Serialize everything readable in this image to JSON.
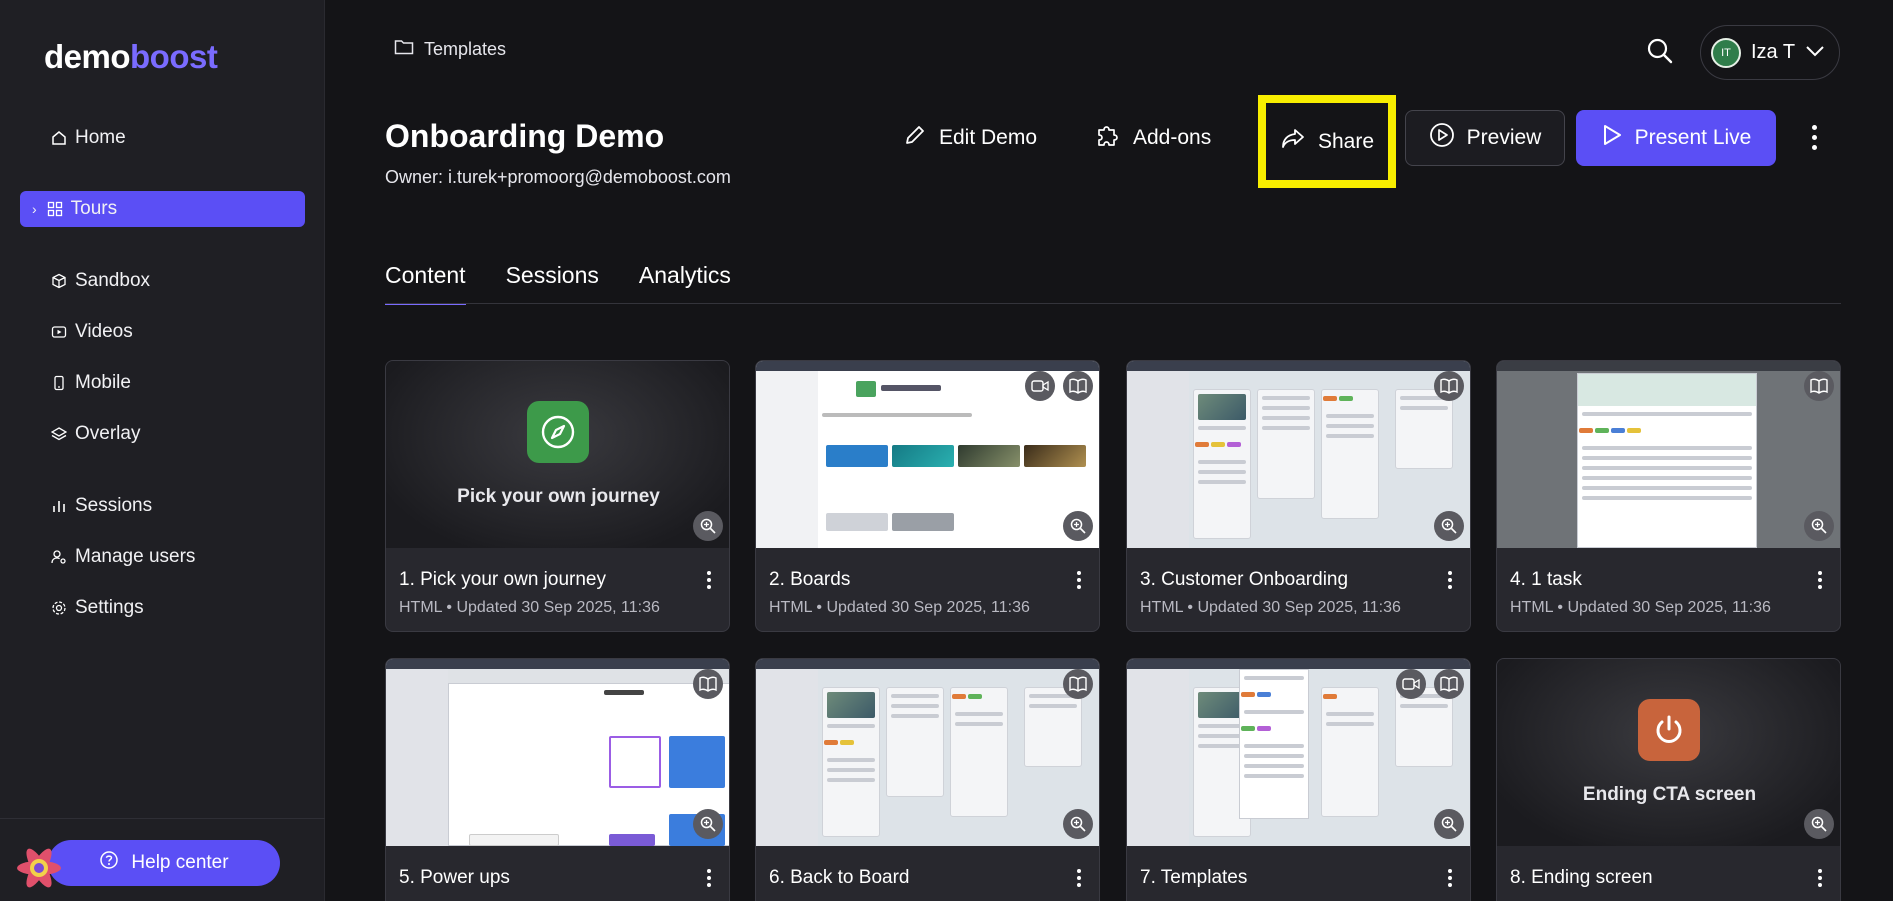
{
  "logo": {
    "part1": "demo",
    "part2": "boost"
  },
  "sidebar": {
    "items": [
      {
        "label": "Home",
        "icon": "home-icon"
      },
      {
        "label": "Tours",
        "icon": "grid-icon",
        "active": true
      },
      {
        "label": "Sandbox",
        "icon": "cube-icon"
      },
      {
        "label": "Videos",
        "icon": "video-icon"
      },
      {
        "label": "Mobile",
        "icon": "mobile-icon"
      },
      {
        "label": "Overlay",
        "icon": "layers-icon"
      },
      {
        "label": "Sessions",
        "icon": "bar-chart-icon"
      },
      {
        "label": "Manage users",
        "icon": "user-gear-icon"
      },
      {
        "label": "Settings",
        "icon": "gear-icon"
      }
    ],
    "help_label": "Help center"
  },
  "header": {
    "breadcrumb": "Templates",
    "user_initials": "IT",
    "user_name": "Iza T"
  },
  "demo": {
    "title": "Onboarding Demo",
    "owner": "Owner: i.turek+promoorg@demoboost.com"
  },
  "actions": {
    "edit": "Edit Demo",
    "addons": "Add-ons",
    "share": "Share",
    "preview": "Preview",
    "present": "Present Live"
  },
  "tabs": [
    "Content",
    "Sessions",
    "Analytics"
  ],
  "cards": [
    {
      "title": "1. Pick your own journey",
      "meta": "HTML • Updated 30 Sep 2025, 11:36",
      "thumb_label": "Pick your own journey"
    },
    {
      "title": "2. Boards",
      "meta": "HTML • Updated 30 Sep 2025, 11:36"
    },
    {
      "title": "3. Customer Onboarding",
      "meta": "HTML • Updated 30 Sep 2025, 11:36"
    },
    {
      "title": "4. 1 task",
      "meta": "HTML • Updated 30 Sep 2025, 11:36"
    },
    {
      "title": "5. Power ups",
      "meta": ""
    },
    {
      "title": "6. Back to Board",
      "meta": ""
    },
    {
      "title": "7. Templates",
      "meta": ""
    },
    {
      "title": "8. Ending screen",
      "meta": "",
      "thumb_label": "Ending CTA screen"
    }
  ],
  "colors": {
    "accent": "#5b4ff5",
    "highlight": "#f8ee00",
    "journey_icon": "#3d9a4a",
    "cta_icon": "#c8643c"
  }
}
